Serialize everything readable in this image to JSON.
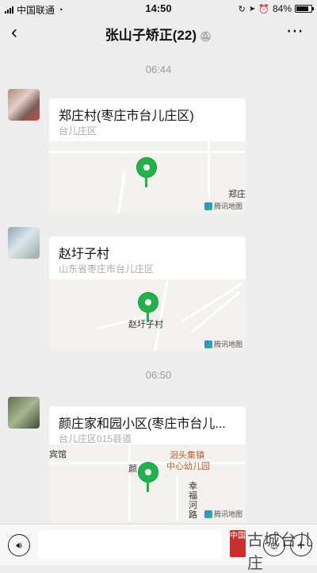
{
  "status_bar": {
    "carrier": "中国联通",
    "time": "14:50",
    "battery": "84%",
    "battery_level": 0.84
  },
  "nav": {
    "title": "张山子矫正(22)",
    "back_icon": "chevron-left-icon",
    "mute_icon": "bell-muted-icon",
    "more_icon": "more-dots-icon"
  },
  "chat": {
    "time_labels": [
      "06:44",
      "06:50"
    ],
    "messages": [
      {
        "title": "郑庄村(枣庄市台儿庄区)",
        "subtitle": "台儿庄区",
        "map_labels": [
          "郑庄"
        ],
        "provider": "腾讯地图"
      },
      {
        "title": "赵圩子村",
        "subtitle": "山东省枣庄市台儿庄区",
        "map_labels": [
          "赵圩子村"
        ],
        "provider": "腾讯地图"
      },
      {
        "title": "颜庄家和园小区(枣庄市台儿...",
        "subtitle": "台儿庄区015县道",
        "map_labels": [
          "宾馆",
          "颜",
          "洄头集镇",
          "中心幼儿园",
          "幸",
          "福",
          "河",
          "路"
        ],
        "provider": "腾讯地图"
      }
    ]
  },
  "input_bar": {
    "voice_icon": "voice-icon",
    "emoji_icon": "emoji-icon",
    "plus_icon": "plus-icon"
  },
  "watermark": {
    "seal_text": "中国",
    "text": "古城台儿庄"
  }
}
